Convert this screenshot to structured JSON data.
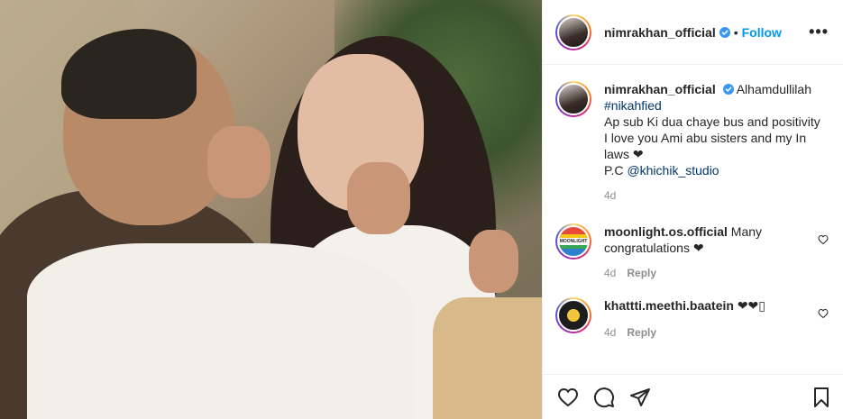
{
  "post": {
    "author": "nimrakhan_official",
    "follow_label": "Follow",
    "separator": "•",
    "more_label": "•••"
  },
  "caption": {
    "username": "nimrakhan_official",
    "line1": "Alhamdullilah",
    "hashtag": "#nikahfied",
    "line2": "Ap sub Ki dua chaye bus and positivity",
    "line3": "I love you Ami abu sisters and my In laws ❤",
    "pc_prefix": "P.C ",
    "pc_handle": "@khichik_studio",
    "time": "4d"
  },
  "comments": [
    {
      "username": "moonlight.os.official",
      "text": "Many congratulations ❤",
      "time": "4d",
      "reply_label": "Reply",
      "avatar_text": "MOONLIGHT"
    },
    {
      "username": "khattti.meethi.baatein",
      "text": "❤❤▯",
      "time": "4d",
      "reply_label": "Reply"
    }
  ],
  "icons": {
    "verified": "verified-badge-icon",
    "like": "heart-icon",
    "comment": "comment-icon",
    "share": "share-icon",
    "save": "bookmark-icon",
    "more": "more-options-icon"
  },
  "colors": {
    "accent": "#0095f6",
    "link": "#00376b",
    "secondary_text": "#8e8e8e",
    "border": "#efefef"
  }
}
